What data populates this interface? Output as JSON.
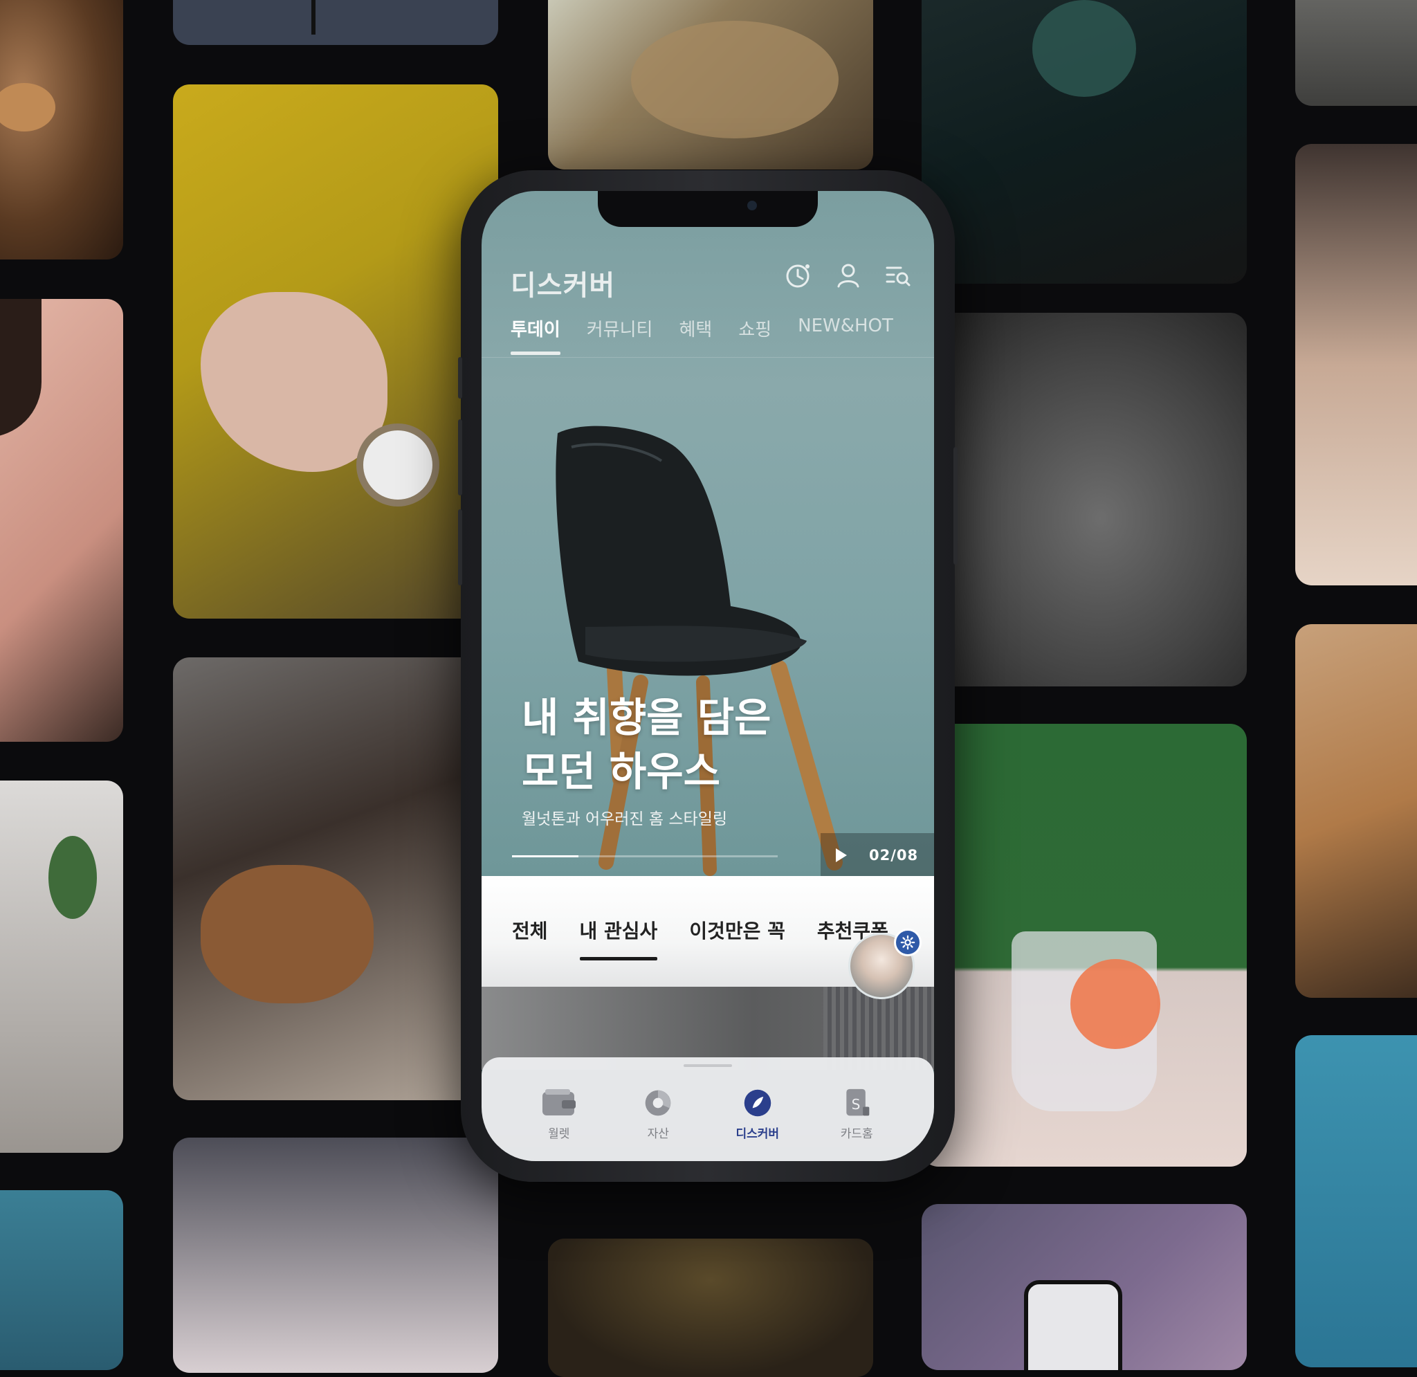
{
  "app": {
    "header": {
      "title": "디스커버"
    },
    "icons": [
      "clock-icon",
      "profile-icon",
      "menu-search-icon"
    ],
    "top_tabs": [
      {
        "label": "투데이",
        "active": true
      },
      {
        "label": "커뮤니티",
        "active": false
      },
      {
        "label": "혜택",
        "active": false
      },
      {
        "label": "쇼핑",
        "active": false
      },
      {
        "label": "NEW&HOT",
        "active": false
      }
    ],
    "hero": {
      "title_line1": "내 취향을 담은",
      "title_line2": "모던 하우스",
      "subtitle": "월넛톤과 어우러진 홈 스타일링",
      "progress": 0.25,
      "counter": "02/08"
    },
    "sub_tabs": [
      {
        "label": "전체",
        "active": false
      },
      {
        "label": "내 관심사",
        "active": true
      },
      {
        "label": "이것만은 꼭",
        "active": false
      },
      {
        "label": "추천쿠폰",
        "active": false
      }
    ],
    "bottom_nav": [
      {
        "label": "월렛",
        "icon": "wallet-icon",
        "active": false
      },
      {
        "label": "자산",
        "icon": "pie-chart-icon",
        "active": false
      },
      {
        "label": "디스커버",
        "icon": "compass-icon",
        "active": true
      },
      {
        "label": "카드홈",
        "icon": "card-home-icon",
        "active": false
      }
    ]
  },
  "colors": {
    "accent": "#2b3f8c",
    "settings_badge": "#2f5aa8",
    "background": "#0b0b0d"
  }
}
